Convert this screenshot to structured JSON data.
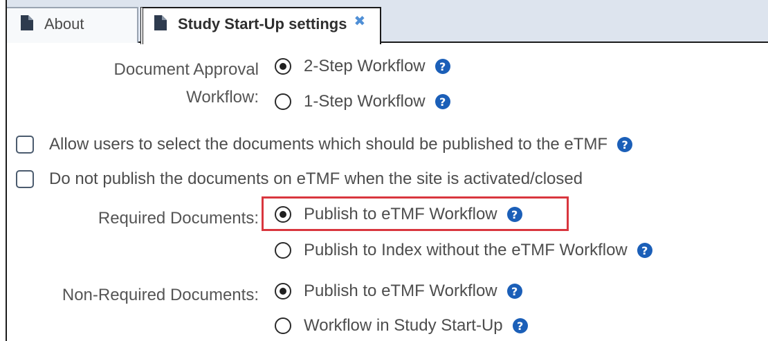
{
  "tabs": [
    {
      "label": "About",
      "icon": "document-icon",
      "active": false
    },
    {
      "label": "Study Start-Up settings",
      "icon": "document-icon",
      "active": true,
      "close": "✖"
    }
  ],
  "document_approval": {
    "label_line1": "Document Approval",
    "label_line2": "Workflow:",
    "options": [
      {
        "label": "2-Step Workflow",
        "selected": true
      },
      {
        "label": "1-Step Workflow",
        "selected": false
      }
    ]
  },
  "checkboxes": [
    {
      "label": "Allow users to select the documents which should be published to the eTMF",
      "checked": false,
      "help": true
    },
    {
      "label": "Do not publish the documents on eTMF when the site is activated/closed",
      "checked": false,
      "help": false
    }
  ],
  "required_documents": {
    "label": "Required Documents:",
    "options": [
      {
        "label": "Publish to eTMF Workflow",
        "selected": true
      },
      {
        "label": "Publish to Index without the eTMF Workflow",
        "selected": false
      }
    ]
  },
  "non_required_documents": {
    "label": "Non-Required Documents:",
    "options": [
      {
        "label": "Publish to eTMF Workflow",
        "selected": true
      },
      {
        "label": "Workflow in Study Start-Up",
        "selected": false
      }
    ]
  },
  "help_glyph": "?",
  "colors": {
    "help": "#1b5fb8",
    "highlight": "#d9363e",
    "close": "#4f8fd6",
    "tabbar": "#dde4ee"
  }
}
